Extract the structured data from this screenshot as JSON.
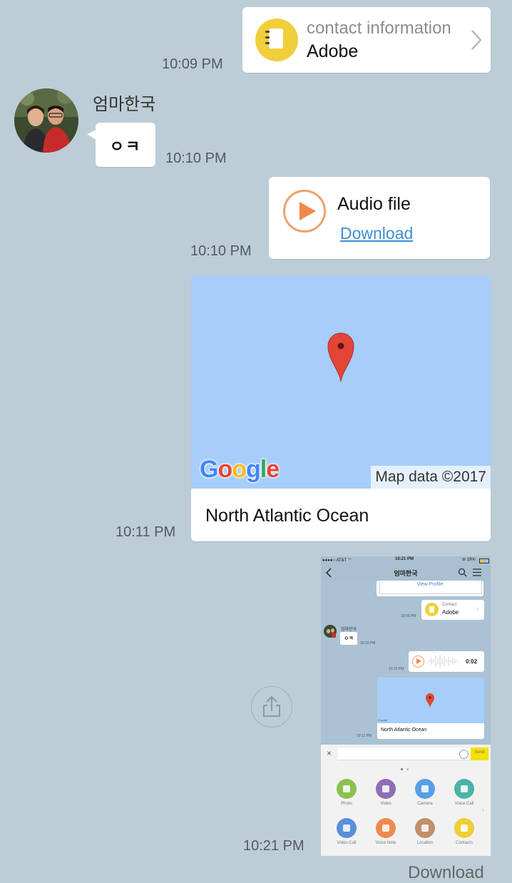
{
  "colors": {
    "background": "#bccdd7",
    "bubble": "#ffffff",
    "contact_yellow": "#f1ce3b",
    "audio_orange": "#f0884a",
    "map_water": "#a7cdfb",
    "link_blue": "#3d8ed8"
  },
  "messages": {
    "contact": {
      "label": "contact information",
      "name": "Adobe",
      "time": "10:09 PM",
      "icon": "contact-book-icon"
    },
    "friend": {
      "name": "엄마한국",
      "text": "ㅇㅋ",
      "time": "10:10 PM"
    },
    "audio": {
      "title": "Audio file",
      "download_label": "Download",
      "time": "10:10 PM",
      "icon": "play-icon"
    },
    "map": {
      "caption": "North Atlantic Ocean",
      "attribution": "Map data ©2017",
      "logo": "Google",
      "time": "10:11 PM",
      "icon": "map-pin-icon"
    },
    "screenshot": {
      "time": "10:21 PM",
      "download_label": "Download",
      "share_icon": "share-icon"
    }
  },
  "thumb": {
    "carrier": "●●●●○ AT&T ⌔",
    "clock": "10:21 PM",
    "battery": "⊛ 19%",
    "title": "엄마한국",
    "view_profile": "View Profile",
    "contact_label": "Contact",
    "contact_name": "Adobe",
    "time1": "10:09 PM",
    "friend_name": "엄마한국",
    "friend_text": "ㅇㅋ",
    "time2": "10:10 PM",
    "audio_duration": "0:02",
    "time3": "10:10 PM",
    "map_caption": "North Atlantic Ocean",
    "map_logo": "Google",
    "time4": "10:11 PM",
    "send": "Send",
    "apps": [
      {
        "label": "Photo",
        "color": "#8cc152"
      },
      {
        "label": "Video",
        "color": "#8e6fb5"
      },
      {
        "label": "Camera",
        "color": "#5a9ee8"
      },
      {
        "label": "Voice Call",
        "color": "#4bb3a5"
      },
      {
        "label": "Video Call",
        "color": "#5b8fd8"
      },
      {
        "label": "Voice Note",
        "color": "#ef8a4d"
      },
      {
        "label": "Location",
        "color": "#c0906a"
      },
      {
        "label": "Contacts",
        "color": "#f0ce35"
      }
    ]
  }
}
